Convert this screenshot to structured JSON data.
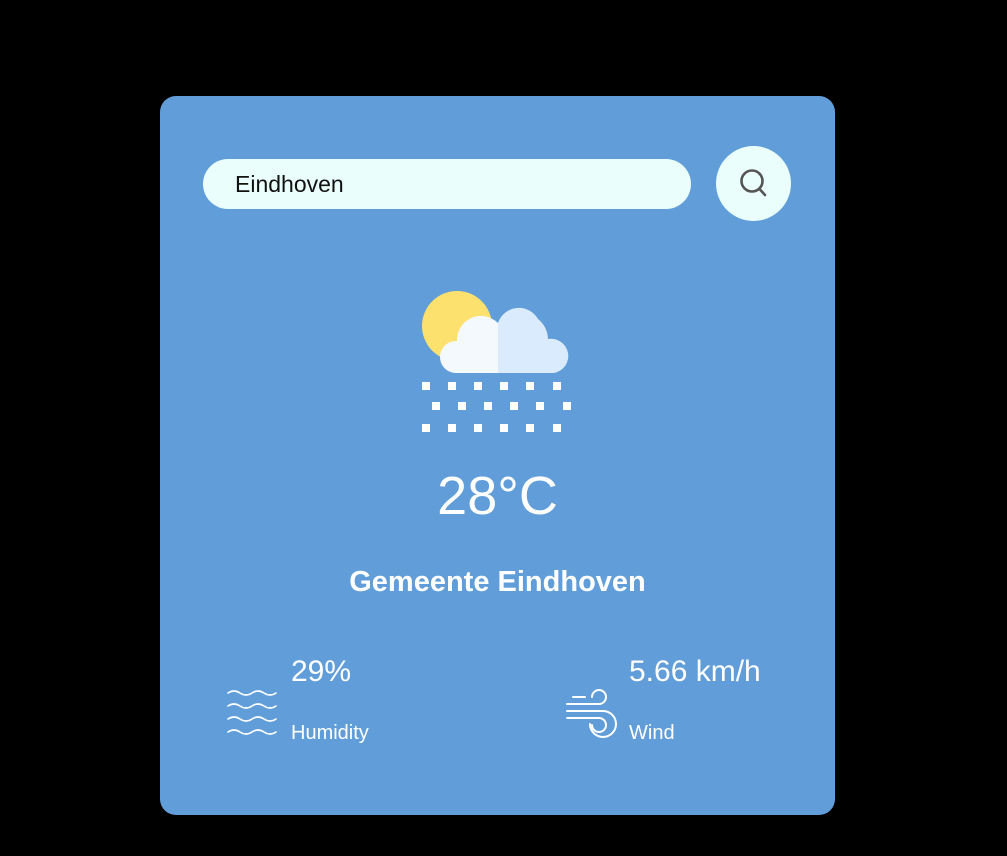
{
  "search": {
    "value": "Eindhoven",
    "button_icon": "search-icon"
  },
  "weather": {
    "icon": "sun-cloud-snow-icon",
    "temperature": "28°C",
    "city": "Gemeente Eindhoven"
  },
  "humidity": {
    "icon": "humidity-waves-icon",
    "value": "29%",
    "label": "Humidity"
  },
  "wind": {
    "icon": "wind-icon",
    "value": "5.66 km/h",
    "label": "Wind"
  },
  "colors": {
    "page_background": "#000000",
    "card_background": "#619ed9",
    "input_background": "#eafffb",
    "text": "#ffffff",
    "sun": "#fde16e"
  }
}
